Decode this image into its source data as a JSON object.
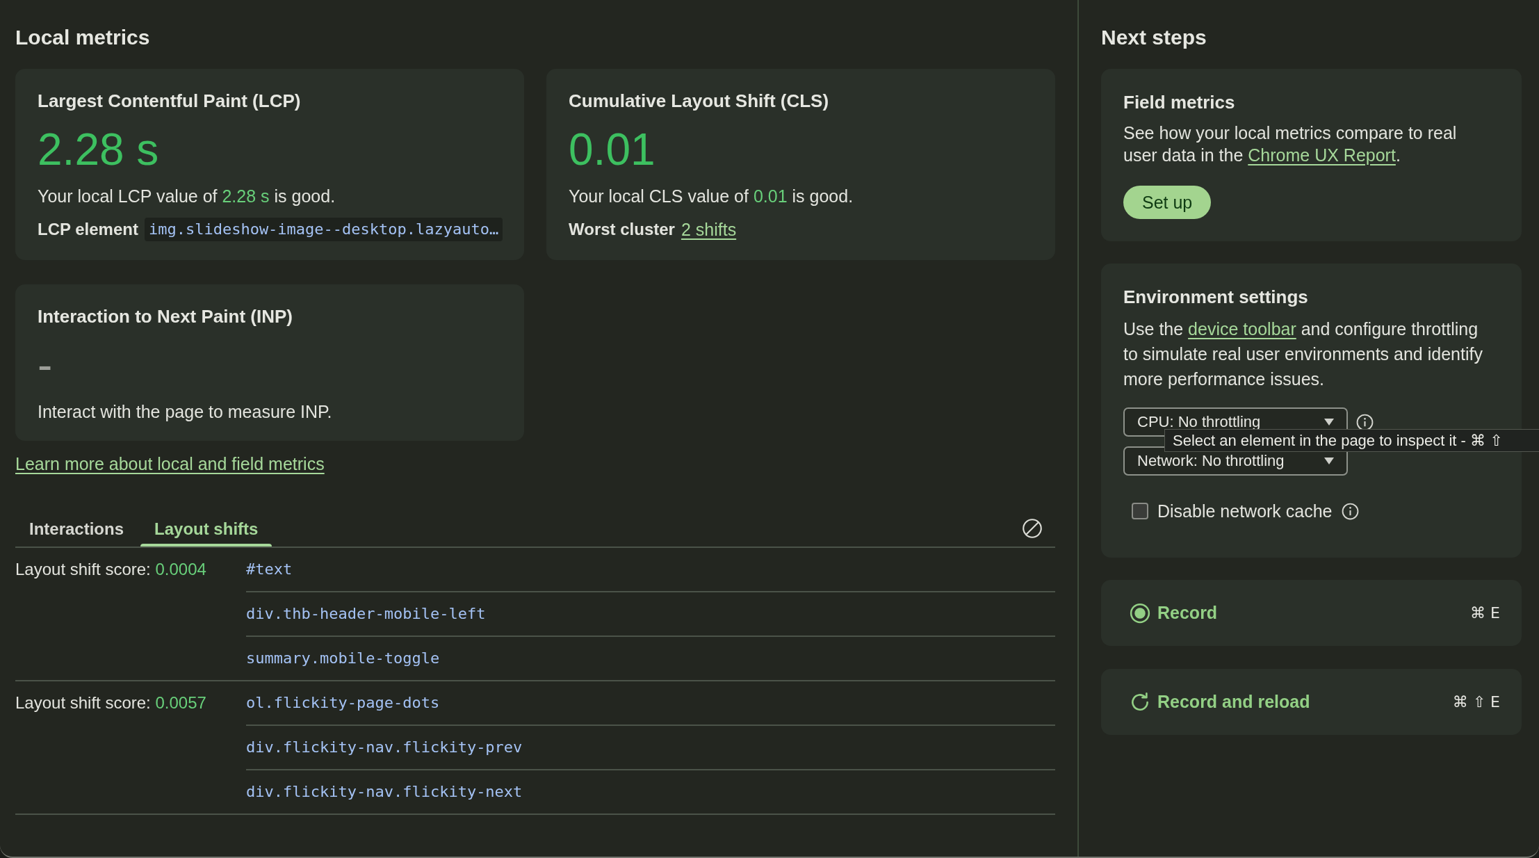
{
  "local_metrics": {
    "title": "Local metrics",
    "cards": [
      {
        "title": "Largest Contentful Paint (LCP)",
        "value": "2.28 s",
        "good": true,
        "summary": {
          "before": "Your local LCP value of ",
          "value": "2.28 s",
          "after": " is good."
        },
        "detail": {
          "kind": "code",
          "label": "LCP element",
          "text": "img.slideshow-image--desktop.lazyauto…"
        }
      },
      {
        "title": "Cumulative Layout Shift (CLS)",
        "value": "0.01",
        "good": true,
        "summary": {
          "before": "Your local CLS value of ",
          "value": "0.01",
          "after": " is good."
        },
        "detail": {
          "kind": "link",
          "label": "Worst cluster",
          "text": "2 shifts"
        }
      },
      {
        "title": "Interaction to Next Paint (INP)",
        "value": "-",
        "good": false,
        "description": "Interact with the page to measure INP."
      }
    ],
    "learn_more_link": "Learn more about local and field metrics"
  },
  "details": {
    "tabs": [
      {
        "label": "Interactions",
        "selected": false
      },
      {
        "label": "Layout shifts",
        "selected": true
      }
    ],
    "layout_shifts": [
      {
        "label": "Layout shift score:",
        "score": "0.0004",
        "nodes": [
          "#text",
          "div.thb-header-mobile-left",
          "summary.mobile-toggle"
        ]
      },
      {
        "label": "Layout shift score:",
        "score": "0.0057",
        "nodes": [
          "ol.flickity-page-dots",
          "div.flickity-nav.flickity-prev",
          "div.flickity-nav.flickity-next"
        ]
      }
    ]
  },
  "next_steps": {
    "title": "Next steps",
    "field_metrics": {
      "title": "Field metrics",
      "text": {
        "before": "See how your local metrics compare to real user data in the ",
        "link": "Chrome UX Report",
        "after": "."
      },
      "button": "Set up"
    },
    "environment": {
      "title": "Environment settings",
      "text": {
        "before": "Use the ",
        "link": "device toolbar",
        "after": " and configure throttling to simulate real user environments and identify more performance issues."
      },
      "selects": [
        {
          "value": "CPU: No throttling",
          "info_icon": true
        },
        {
          "value": "Network: No throttling",
          "info_icon": false
        }
      ],
      "checkbox": {
        "label": "Disable network cache",
        "checked": false
      }
    },
    "actions": [
      {
        "kind": "record",
        "label": "Record",
        "shortcut": "⌘ E"
      },
      {
        "kind": "reload",
        "label": "Record and reload",
        "shortcut": "⌘ ⇧ E"
      }
    ]
  },
  "tooltip": "Select an element in the page to inspect it - ⌘ ⇧"
}
